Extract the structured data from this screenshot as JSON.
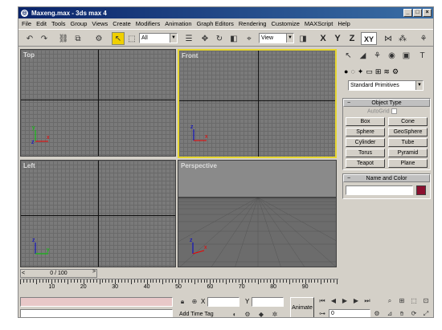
{
  "window": {
    "title": "Maxeng.max - 3ds max 4",
    "controls": [
      "_",
      "□",
      "×"
    ]
  },
  "menu": [
    "File",
    "Edit",
    "Tools",
    "Group",
    "Views",
    "Create",
    "Modifiers",
    "Animation",
    "Graph Editors",
    "Rendering",
    "Customize",
    "MAXScript",
    "Help"
  ],
  "toolbar": {
    "selection_filter": "All",
    "coord_system": "View",
    "axes": [
      "X",
      "Y",
      "Z",
      "XY"
    ]
  },
  "viewports": [
    {
      "label": "Top"
    },
    {
      "label": "Front"
    },
    {
      "label": "Left"
    },
    {
      "label": "Perspective"
    }
  ],
  "command_panel": {
    "category": "Standard Primitives",
    "object_type_title": "Object Type",
    "autogrid_label": "AutoGrid",
    "objects": [
      "Box",
      "Cone",
      "Sphere",
      "GeoSphere",
      "Cylinder",
      "Tube",
      "Torus",
      "Pyramid",
      "Teapot",
      "Plane"
    ],
    "name_color_title": "Name and Color",
    "object_color": "#8b1030"
  },
  "time": {
    "slider_text": "0 / 100",
    "ruler_labels": [
      "10",
      "20",
      "30",
      "40",
      "50",
      "60",
      "70",
      "80",
      "90"
    ]
  },
  "status": {
    "x_label": "X",
    "y_label": "Y",
    "animate_label": "Animate",
    "add_time_tag": "Add Time Tag",
    "frame_value": "0"
  },
  "colors": {
    "viewport_active_border": "#e6d630",
    "viewport_bg": "#7a7a7a",
    "toolbar_selected": "#f0d000"
  }
}
